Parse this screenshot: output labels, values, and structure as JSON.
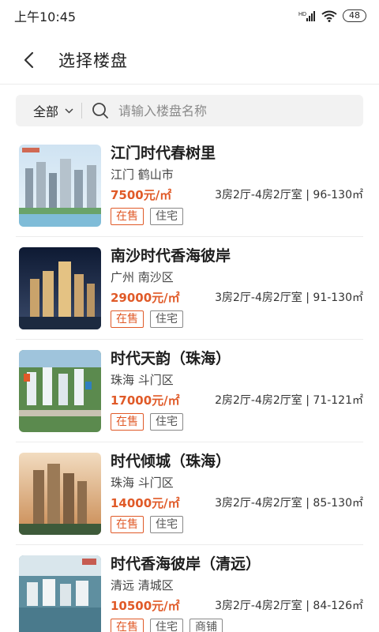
{
  "status_bar": {
    "time": "上午10:45",
    "battery": "48",
    "icons": [
      "hd-signal-icon",
      "wifi-icon",
      "battery-icon"
    ]
  },
  "header": {
    "title": "选择楼盘",
    "back_icon": "chevron-left-icon"
  },
  "search": {
    "city": "全部",
    "placeholder": "请输入楼盘名称",
    "icon": "search-icon"
  },
  "colors": {
    "accent": "#e05a28",
    "tag_gray": "#888888"
  },
  "listings": [
    {
      "name": "江门时代春树里",
      "location": "江门 鹤山市",
      "price": "7500元/㎡",
      "rooms": "3房2厅-4房2厅室 | 96-130㎡",
      "tags": [
        {
          "label": "在售",
          "style": "red"
        },
        {
          "label": "住宅",
          "style": "gray"
        }
      ]
    },
    {
      "name": "南沙时代香海彼岸",
      "location": "广州 南沙区",
      "price": "29000元/㎡",
      "rooms": "3房2厅-4房2厅室 | 91-130㎡",
      "tags": [
        {
          "label": "在售",
          "style": "red"
        },
        {
          "label": "住宅",
          "style": "gray"
        }
      ]
    },
    {
      "name": "时代天韵（珠海）",
      "location": "珠海 斗门区",
      "price": "17000元/㎡",
      "rooms": "2房2厅-4房2厅室 | 71-121㎡",
      "tags": [
        {
          "label": "在售",
          "style": "red"
        },
        {
          "label": "住宅",
          "style": "gray"
        }
      ]
    },
    {
      "name": "时代倾城（珠海）",
      "location": "珠海 斗门区",
      "price": "14000元/㎡",
      "rooms": "3房2厅-4房2厅室 | 85-130㎡",
      "tags": [
        {
          "label": "在售",
          "style": "red"
        },
        {
          "label": "住宅",
          "style": "gray"
        }
      ]
    },
    {
      "name": "时代香海彼岸（清远）",
      "location": "清远 清城区",
      "price": "10500元/㎡",
      "rooms": "3房2厅-4房2厅室 | 84-126㎡",
      "tags": [
        {
          "label": "在售",
          "style": "red"
        },
        {
          "label": "住宅",
          "style": "gray"
        },
        {
          "label": "商铺",
          "style": "gray"
        }
      ]
    }
  ]
}
